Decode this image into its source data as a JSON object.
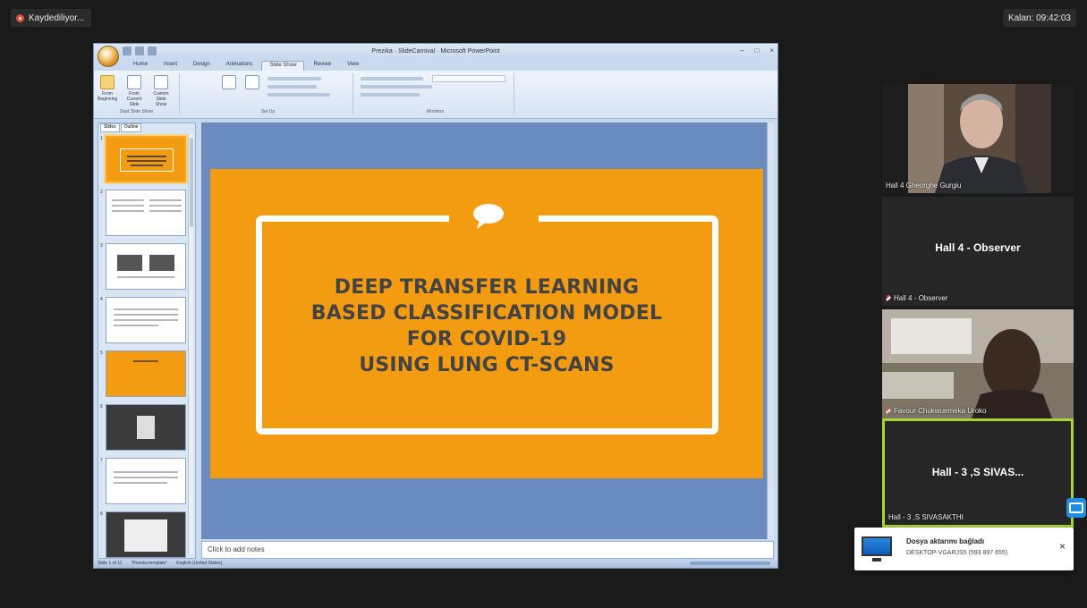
{
  "recording": {
    "label": "Kaydediliyor..."
  },
  "timer": {
    "label": "Kalan: 09:42:03"
  },
  "ppt": {
    "window_title": "Prezika · SlideCarnival · Microsoft PowerPoint",
    "tabs": [
      "Home",
      "Insert",
      "Design",
      "Animations",
      "Slide Show",
      "Review",
      "View"
    ],
    "active_tab": "Slide Show",
    "ribbon": {
      "from_beginning": "From Beginning",
      "from_current": "From Current Slide",
      "custom": "Custom Slide Show",
      "group_start": "Start Slide Show",
      "group_setup": "Set Up",
      "group_monitors": "Monitors"
    },
    "panel_tabs": [
      "Slides",
      "Outline"
    ],
    "slide_count": 8,
    "slide": {
      "title_lines": [
        "DEEP TRANSFER LEARNING",
        "BASED CLASSIFICATION MODEL",
        "FOR COVID-19",
        "USING LUNG CT-SCANS"
      ],
      "accent_color": "#f39c12",
      "text_color": "#434343"
    },
    "notes_placeholder": "Click to add notes",
    "status": {
      "slide_of": "Slide 1 of 11",
      "theme": "\"Prezika template\"",
      "lang": "English (United States)"
    }
  },
  "participants": [
    {
      "name": "Hall 4 Gheorghe Gurgiu",
      "has_video": true,
      "muted": false
    },
    {
      "name": "Hall 4 - Observer",
      "display": "Hall 4 - Observer",
      "has_video": false,
      "muted": true
    },
    {
      "name": "Favour Chukwuemeka Uroko",
      "has_video": true,
      "muted": true
    },
    {
      "name": "Hall - 3 ,S SIVASAKTHI",
      "display": "Hall - 3 ,S SIVAS...",
      "has_video": false,
      "muted": false,
      "active": true
    }
  ],
  "toast": {
    "title": "Dosya aktarımı bağladı",
    "subtitle": "DESKTOP-VGARJS5 (593 897 655)",
    "close": "×"
  },
  "colors": {
    "background": "#1a1a1a",
    "active_speaker": "#a6d33a",
    "slide_orange": "#f39c12"
  }
}
